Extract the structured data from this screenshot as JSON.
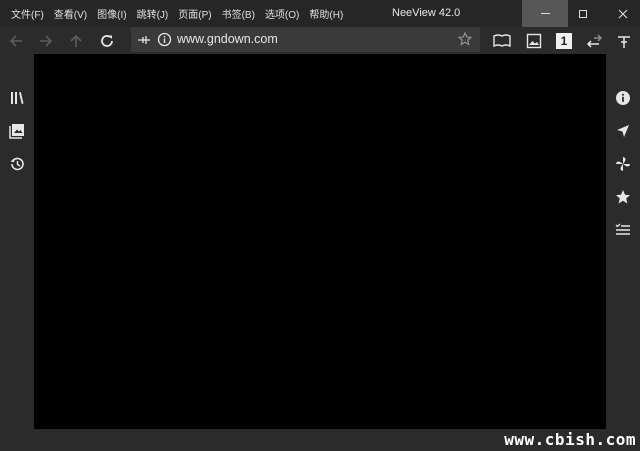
{
  "window": {
    "title": "NeeView 42.0",
    "menu": [
      {
        "label": "文件(F)"
      },
      {
        "label": "查看(V)"
      },
      {
        "label": "图像(I)"
      },
      {
        "label": "跳转(J)"
      },
      {
        "label": "页面(P)"
      },
      {
        "label": "书签(B)"
      },
      {
        "label": "选项(O)"
      },
      {
        "label": "帮助(H)"
      }
    ]
  },
  "toolbar": {
    "address": "www.gndown.com",
    "page_mode_badge": "1"
  },
  "icons": {
    "back": "arrow-left-icon",
    "forward": "arrow-right-icon",
    "up": "arrow-up-icon",
    "reload": "reload-icon",
    "pin": "pin-icon",
    "info": "info-icon",
    "star": "star-icon"
  },
  "watermark": "www.cbish.com",
  "colors": {
    "titlebar": "#262626",
    "panel": "#2b2b2b",
    "address_bg": "#3a3a3a",
    "viewer": "#000000",
    "minimize_hover": "#575757"
  }
}
